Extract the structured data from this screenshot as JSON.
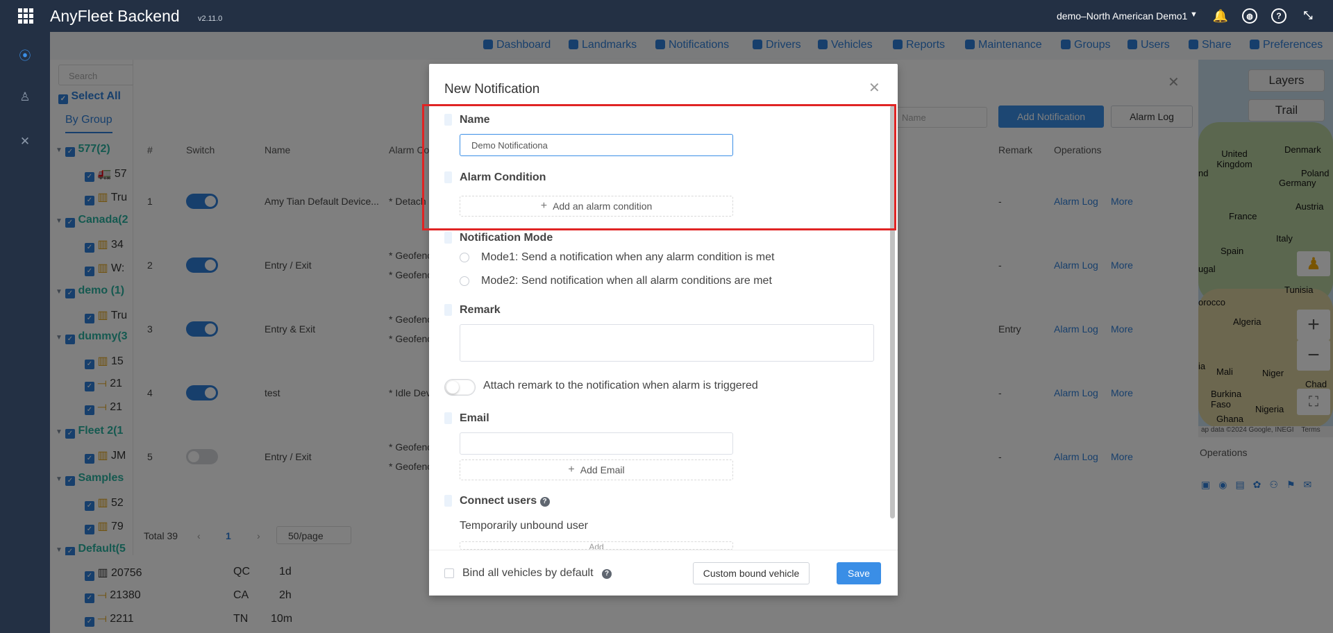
{
  "app": {
    "title": "AnyFleet Backend",
    "version": "v2.11.0",
    "account": "demo–North American Demo1"
  },
  "menu": [
    {
      "label": "Dashboard",
      "icon": "dashboard-icon"
    },
    {
      "label": "Landmarks",
      "icon": "landmark-icon"
    },
    {
      "label": "Notifications",
      "icon": "notification-icon"
    },
    {
      "label": "Drivers",
      "icon": "driver-icon"
    },
    {
      "label": "Vehicles",
      "icon": "vehicle-icon"
    },
    {
      "label": "Reports",
      "icon": "report-icon"
    },
    {
      "label": "Maintenance",
      "icon": "maintenance-icon"
    },
    {
      "label": "Groups",
      "icon": "groups-icon"
    },
    {
      "label": "Users",
      "icon": "users-icon"
    },
    {
      "label": "Share",
      "icon": "share-icon"
    },
    {
      "label": "Preferences",
      "icon": "preferences-icon"
    }
  ],
  "leftpanel": {
    "search_placeholder": "Search",
    "select_all": "Select All",
    "by_group": "By Group",
    "groups": [
      "577(2)",
      "Canada(2",
      "demo (1)",
      "dummy(3",
      "Fleet 2(1",
      "Samples",
      "Default(5"
    ],
    "vehicles": [
      "57",
      "Tru",
      "34",
      "W:",
      "Tru",
      "15",
      "21",
      "21",
      "JM",
      "52",
      "79"
    ],
    "bottom_rows": [
      {
        "name": "20756",
        "state": "QC",
        "time": "1d"
      },
      {
        "name": "21380",
        "state": "CA",
        "time": "2h"
      },
      {
        "name": "2211",
        "state": "TN",
        "time": "10m"
      }
    ]
  },
  "table": {
    "headers": {
      "num": "#",
      "switch": "Switch",
      "name": "Name",
      "alarm": "Alarm Co",
      "remark": "Remark",
      "operations": "Operations"
    },
    "search_placeholder": "Name",
    "add_notification": "Add Notification",
    "alarm_log_btn": "Alarm Log",
    "rows": [
      {
        "num": "1",
        "on": true,
        "name": "Amy Tian Default Device...",
        "alarm": [
          "* Detach"
        ],
        "remark": "-"
      },
      {
        "num": "2",
        "on": true,
        "name": "Entry / Exit",
        "alarm": [
          "* Geofenc",
          "* Geofenc"
        ],
        "remark": "-"
      },
      {
        "num": "3",
        "on": true,
        "name": "Entry & Exit",
        "alarm": [
          "* Geofenc",
          "* Geofenc"
        ],
        "remark": "Entry"
      },
      {
        "num": "4",
        "on": true,
        "name": "test",
        "alarm": [
          "* Idle Dev"
        ],
        "remark": "-"
      },
      {
        "num": "5",
        "on": false,
        "name": "Entry / Exit",
        "alarm": [
          "* Geofenc",
          "* Geofenc"
        ],
        "remark": "-"
      }
    ],
    "op_alarm_log": "Alarm Log",
    "op_more": "More",
    "total": "Total 39",
    "page": "1",
    "page_size": "50/page"
  },
  "map": {
    "layers": "Layers",
    "trail": "Trail",
    "attribution": "ap data ©2024 Google, INEGI",
    "terms": "Terms",
    "operations": "Operations",
    "labels": [
      "United Kingdom",
      "Denmark",
      "Germany",
      "Poland",
      "France",
      "Austria",
      "Italy",
      "Spain",
      "Tunisia",
      "Algeria",
      "Mali",
      "Niger",
      "Chad",
      "Burkina Faso",
      "Nigeria",
      "Ghana",
      "orocco",
      "ugal",
      "ia",
      "nd"
    ]
  },
  "modal": {
    "title": "New Notification",
    "name_label": "Name",
    "name_value": "Demo Notificationa",
    "alarm_label": "Alarm Condition",
    "add_alarm": "Add an alarm condition",
    "mode_label": "Notification Mode",
    "mode1": "Mode1: Send a notification when any alarm condition is met",
    "mode2": "Mode2: Send notification when all alarm conditions are met",
    "remark_label": "Remark",
    "attach_remark": "Attach remark to the notification when alarm is triggered",
    "email_label": "Email",
    "add_email": "Add Email",
    "connect_users": "Connect users",
    "unbound_user": "Temporarily unbound user",
    "add_user_partial": "Add",
    "bind_all": "Bind all vehicles by default",
    "custom_bound": "Custom bound vehicle",
    "save": "Save"
  }
}
